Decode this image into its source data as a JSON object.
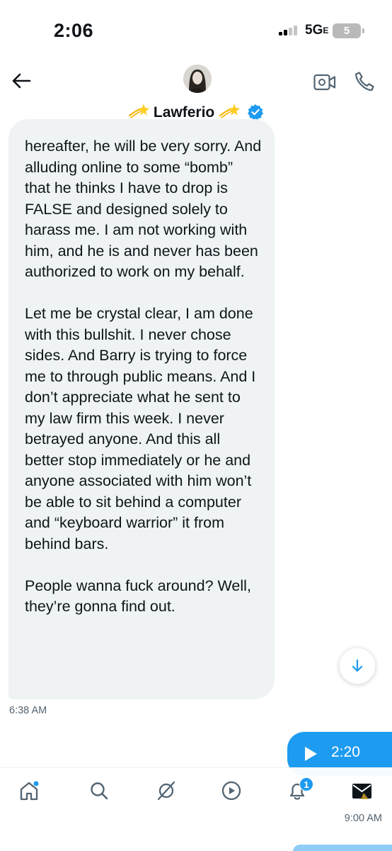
{
  "status_bar": {
    "time": "2:06",
    "network": "5G",
    "network_suffix": "E",
    "battery": "5"
  },
  "header": {
    "contact_name": "Lawferio",
    "name_emoji": "💫",
    "verified": true,
    "icons": [
      "back-arrow-icon",
      "video-call-icon",
      "phone-call-icon",
      "verified-badge-icon"
    ]
  },
  "conversation": {
    "received_message": {
      "paragraphs": [
        "hereafter, he will be very sorry. And alluding online to some “bomb” that he thinks I have to drop is FALSE and designed solely to harass me. I am not working with him, and he is and never has been authorized to work on my behalf.",
        "Let me be crystal clear, I am done with this bullshit. I never chose sides. And Barry is trying to force me to through public means.  And I don’t appreciate what he sent to my law firm this week. I never betrayed anyone. And this all better stop immediately or he and anyone associated with him won’t be able to sit behind a computer and “keyboard warrior” it from behind bars.",
        "People wanna fuck around? Well, they’re gonna find out."
      ],
      "timestamp": "6:38 AM"
    },
    "sent_voice_message": {
      "duration": "2:20",
      "timestamp": "9:00 AM"
    }
  },
  "bottom_nav": {
    "items": [
      "home-icon",
      "search-icon",
      "grok-icon",
      "video-icon",
      "notifications-icon",
      "messages-icon"
    ],
    "notifications_badge": "1",
    "active": "messages"
  },
  "colors": {
    "accent": "#1d9bf0",
    "bubble_bg": "#eff3f4",
    "text": "#0f1419",
    "muted": "#536471"
  }
}
